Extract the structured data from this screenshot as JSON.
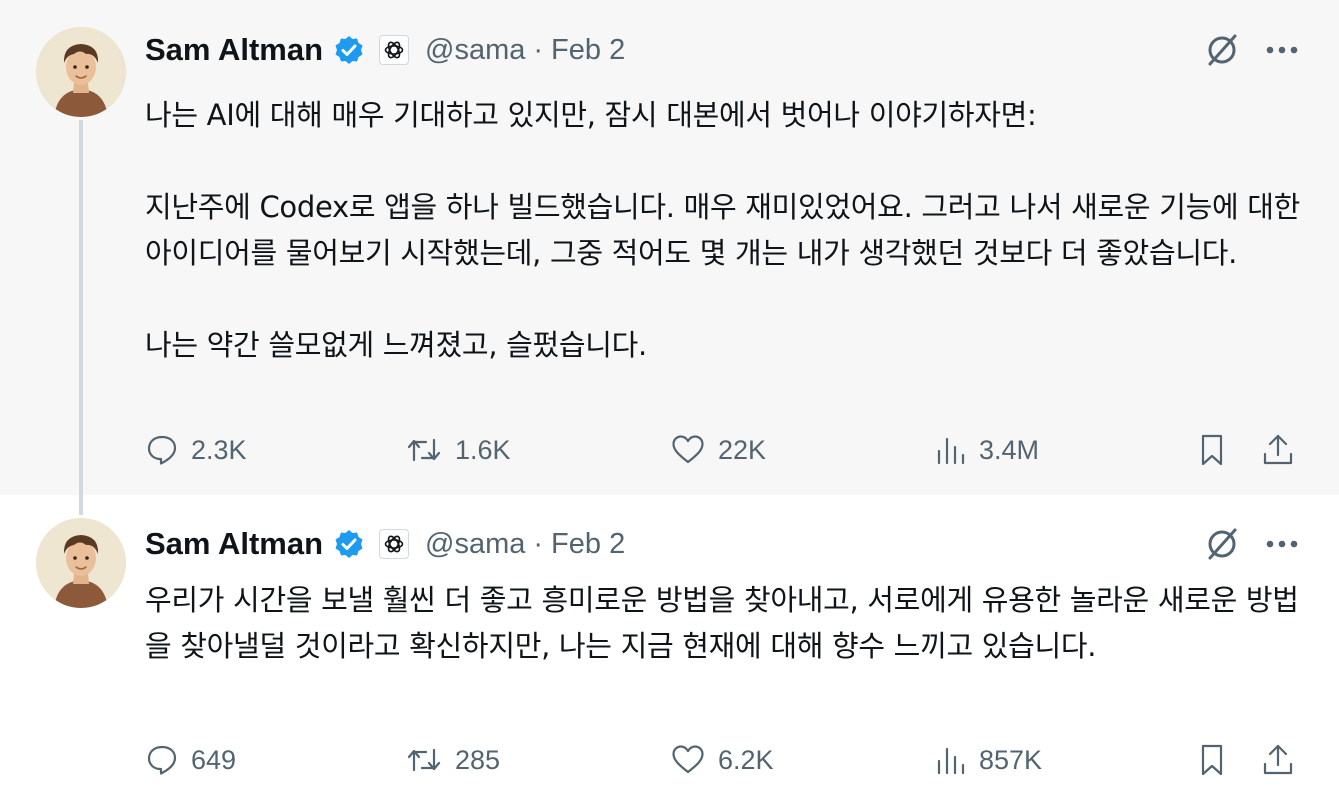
{
  "colors": {
    "verified": "#1d9bf0",
    "text_primary": "#0f1419",
    "text_secondary": "#536471",
    "first_tweet_background": "#f7f7f7"
  },
  "icons": {
    "verified": "verified-badge-icon",
    "affiliate": "openai-logo-icon",
    "grok": "grok-icon",
    "more": "more-icon",
    "reply": "reply-icon",
    "retweet": "retweet-icon",
    "like": "heart-icon",
    "views": "views-icon",
    "bookmark": "bookmark-icon",
    "share": "share-icon"
  },
  "tweets": [
    {
      "author": {
        "name": "Sam Altman",
        "handle": "@sama"
      },
      "separator": "·",
      "date": "Feb 2",
      "text": "나는 AI에 대해 매우 기대하고 있지만, 잠시 대본에서 벗어나 이야기하자면:\n\n지난주에 Codex로 앱을 하나 빌드했습니다. 매우 재미있었어요. 그러고 나서 새로운 기능에 대한 아이디어를 물어보기 시작했는데, 그중 적어도 몇 개는 내가 생각했던 것보다 더 좋았습니다.\n\n나는 약간 쓸모없게 느껴졌고, 슬펐습니다.",
      "stats": {
        "replies": "2.3K",
        "retweets": "1.6K",
        "likes": "22K",
        "views": "3.4M"
      }
    },
    {
      "author": {
        "name": "Sam Altman",
        "handle": "@sama"
      },
      "separator": "·",
      "date": "Feb 2",
      "text": "우리가 시간을 보낼 훨씬 더 좋고 흥미로운 방법을 찾아내고, 서로에게 유용한 놀라운 새로운 방법을 찾아낼덜 것이라고 확신하지만, 나는 지금 현재에 대해 향수 느끼고 있습니다.",
      "stats": {
        "replies": "649",
        "retweets": "285",
        "likes": "6.2K",
        "views": "857K"
      }
    }
  ]
}
